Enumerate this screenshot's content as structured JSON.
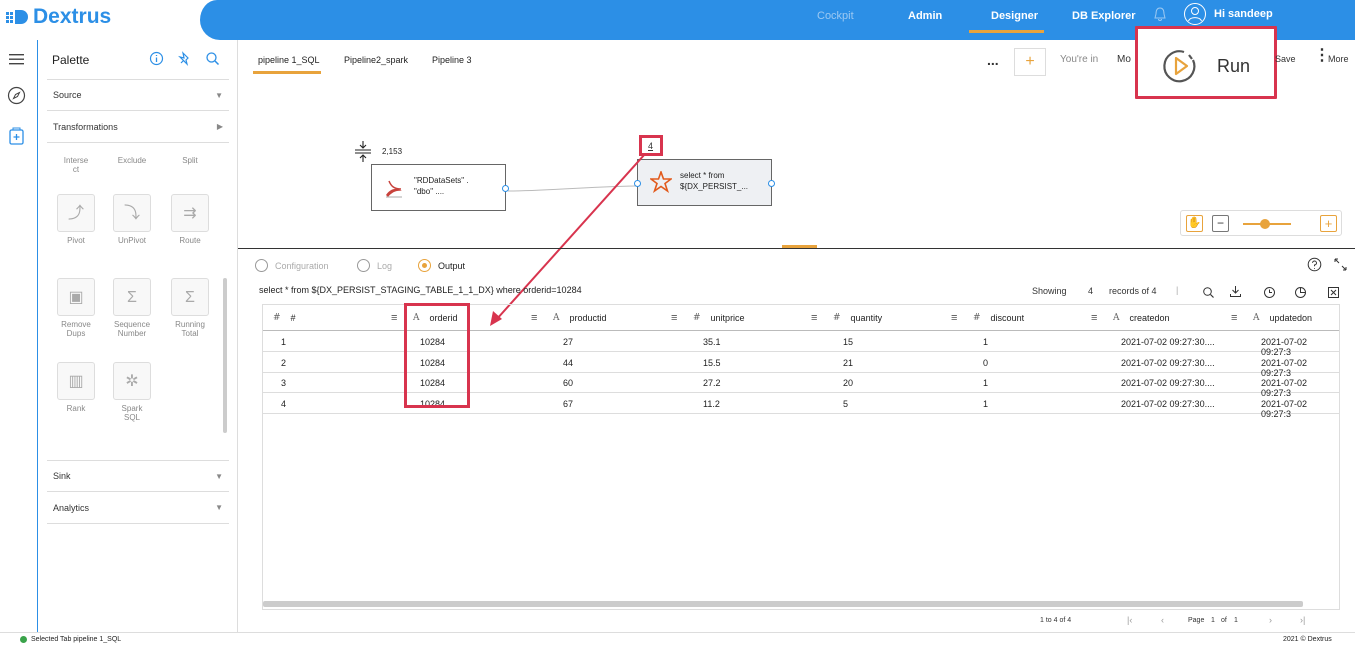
{
  "app": {
    "logo": "Dextrus",
    "user_greeting": "Hi sandeep"
  },
  "nav": {
    "cockpit": "Cockpit",
    "admin": "Admin",
    "designer": "Designer",
    "db_explorer": "DB Explorer"
  },
  "palette": {
    "title": "Palette",
    "source": "Source",
    "transformations": "Transformations",
    "sink": "Sink",
    "analytics": "Analytics",
    "tools": [
      {
        "label": "Intersect"
      },
      {
        "label": "Exclude"
      },
      {
        "label": "Split"
      },
      {
        "label": "Pivot"
      },
      {
        "label": "UnPivot"
      },
      {
        "label": "Route"
      },
      {
        "label": "Remove Dups"
      },
      {
        "label": "Sequence Number"
      },
      {
        "label": "Running Total"
      },
      {
        "label": "Rank"
      },
      {
        "label": "Spark SQL"
      }
    ]
  },
  "tabs": [
    {
      "label": "pipeline 1_SQL"
    },
    {
      "label": "Pipeline2_spark"
    },
    {
      "label": "Pipeline 3"
    }
  ],
  "toolbar": {
    "ellipsis": "...",
    "plus": "+",
    "youre_in": "You're in",
    "mode": "Mo",
    "run": "Run",
    "save": "Save",
    "more": "More"
  },
  "canvas": {
    "row_count": "2,153",
    "source_node": {
      "line1": "\"RDDataSets\" .",
      "line2": "\"dbo\" ...."
    },
    "link_count": "4",
    "sql_node": {
      "line1": "select * from",
      "line2": "${DX_PERSIST_..."
    }
  },
  "zoom": {
    "minus": "−",
    "plus": "+",
    "level": 0.45
  },
  "output": {
    "tabs": {
      "configuration": "Configuration",
      "log": "Log",
      "output": "Output"
    },
    "query": "select * from ${DX_PERSIST_STAGING_TABLE_1_1_DX} where orderid=10284",
    "showing": "Showing",
    "count": "4",
    "records_of": "records of 4",
    "columns": [
      {
        "type": "#",
        "name": "#"
      },
      {
        "type": "A",
        "name": "orderid"
      },
      {
        "type": "A",
        "name": "productid"
      },
      {
        "type": "#",
        "name": "unitprice"
      },
      {
        "type": "#",
        "name": "quantity"
      },
      {
        "type": "#",
        "name": "discount"
      },
      {
        "type": "A",
        "name": "createdon"
      },
      {
        "type": "A",
        "name": "updatedon"
      }
    ],
    "rows": [
      [
        "1",
        "10284",
        "27",
        "35.1",
        "15",
        "1",
        "2021-07-02 09:27:30....",
        "2021-07-02 09:27:3"
      ],
      [
        "2",
        "10284",
        "44",
        "15.5",
        "21",
        "0",
        "2021-07-02 09:27:30....",
        "2021-07-02 09:27:3"
      ],
      [
        "3",
        "10284",
        "60",
        "27.2",
        "20",
        "1",
        "2021-07-02 09:27:30....",
        "2021-07-02 09:27:3"
      ],
      [
        "4",
        "10284",
        "67",
        "11.2",
        "5",
        "1",
        "2021-07-02 09:27:30....",
        "2021-07-02 09:27:3"
      ]
    ],
    "pager": {
      "range": "1 to 4 of 4",
      "page": "Page",
      "page_num": "1",
      "of": "of",
      "total": "1"
    }
  },
  "status": {
    "selected": "Selected Tab pipeline 1_SQL",
    "copyright": "2021 © Dextrus"
  },
  "colors": {
    "brand": "#2c8fe6",
    "accent": "#e8a33c",
    "highlight": "#d8344e"
  }
}
